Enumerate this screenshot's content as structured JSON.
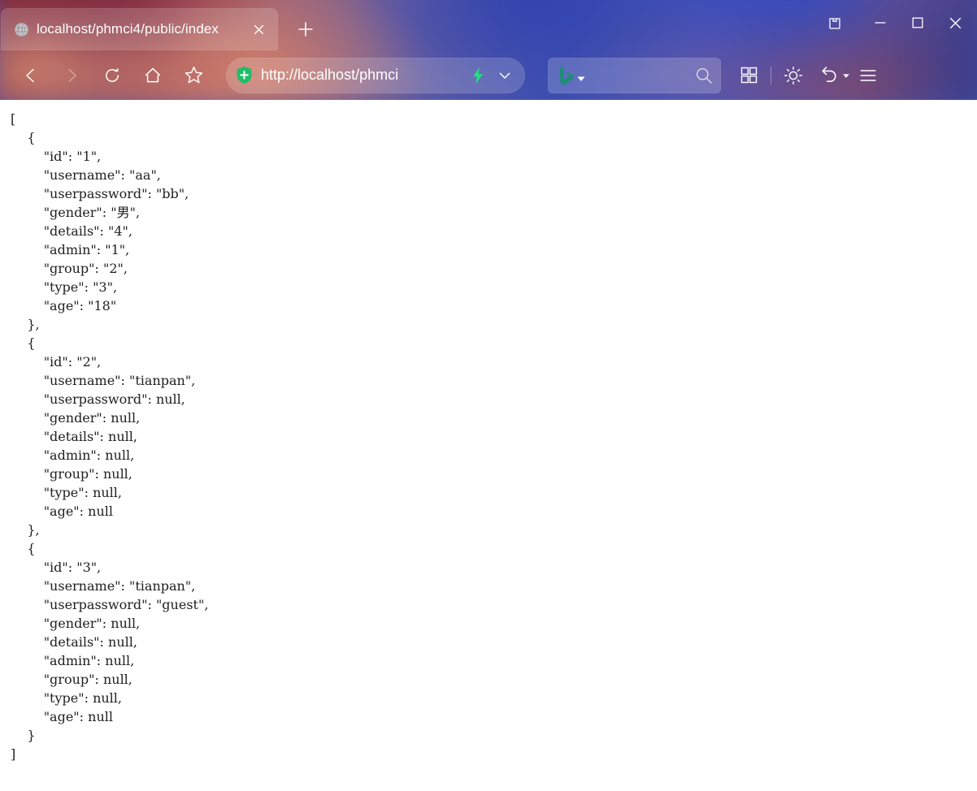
{
  "window": {
    "controls": [
      {
        "name": "split-screen-icon",
        "label": "Split screen"
      },
      {
        "name": "minimize-icon",
        "label": "Minimize"
      },
      {
        "name": "maximize-icon",
        "label": "Maximize"
      },
      {
        "name": "close-icon",
        "label": "Close"
      }
    ]
  },
  "tabs": {
    "active": {
      "favicon": "globe-icon",
      "title": "localhost/phmci4/public/index",
      "close_label": "✕"
    },
    "new_tab_label": "+"
  },
  "toolbar": {
    "back_label": "Back",
    "forward_label": "Forward",
    "reload_label": "Refresh",
    "home_label": "Home",
    "favorite_label": "Add this page to favorites",
    "omnibox": {
      "shield_icon": "shield-plus-icon",
      "url": "http://localhost/phmci",
      "bolt_icon": "lightning-bolt-icon",
      "caret_icon": "chevron-down-icon"
    },
    "search": {
      "engine_icon": "bing-logo-icon",
      "engine_caret_icon": "caret-down-icon",
      "value": "",
      "placeholder": "",
      "search_icon": "magnifier-icon"
    },
    "right_buttons": [
      {
        "name": "collections-icon",
        "label": "Collections"
      },
      {
        "name": "brightness-icon",
        "label": "Appearance"
      },
      {
        "name": "history-undo-icon",
        "label": "History"
      },
      {
        "name": "hamburger-menu-icon",
        "label": "Settings and more"
      }
    ]
  },
  "content": {
    "content_type": "application/json",
    "json_text": "[\n    {\n        \"id\": \"1\",\n        \"username\": \"aa\",\n        \"userpassword\": \"bb\",\n        \"gender\": \"男\",\n        \"details\": \"4\",\n        \"admin\": \"1\",\n        \"group\": \"2\",\n        \"type\": \"3\",\n        \"age\": \"18\"\n    },\n    {\n        \"id\": \"2\",\n        \"username\": \"tianpan\",\n        \"userpassword\": null,\n        \"gender\": null,\n        \"details\": null,\n        \"admin\": null,\n        \"group\": null,\n        \"type\": null,\n        \"age\": null\n    },\n    {\n        \"id\": \"3\",\n        \"username\": \"tianpan\",\n        \"userpassword\": \"guest\",\n        \"gender\": null,\n        \"details\": null,\n        \"admin\": null,\n        \"group\": null,\n        \"type\": null,\n        \"age\": null\n    }\n]",
    "records": [
      {
        "id": "1",
        "username": "aa",
        "userpassword": "bb",
        "gender": "男",
        "details": "4",
        "admin": "1",
        "group": "2",
        "type": "3",
        "age": "18"
      },
      {
        "id": "2",
        "username": "tianpan",
        "userpassword": null,
        "gender": null,
        "details": null,
        "admin": null,
        "group": null,
        "type": null,
        "age": null
      },
      {
        "id": "3",
        "username": "tianpan",
        "userpassword": "guest",
        "gender": null,
        "details": null,
        "admin": null,
        "group": null,
        "type": null,
        "age": null
      }
    ]
  },
  "colors": {
    "chrome_left": "#7a2336",
    "chrome_mid": "#3c4fb0",
    "chrome_right": "#3a3f8c",
    "page_bg": "#ffffff",
    "text": "#202020",
    "shield_green": "#1fb866",
    "bolt_green": "#1be07a",
    "bing_teal": "#1b8b72"
  }
}
